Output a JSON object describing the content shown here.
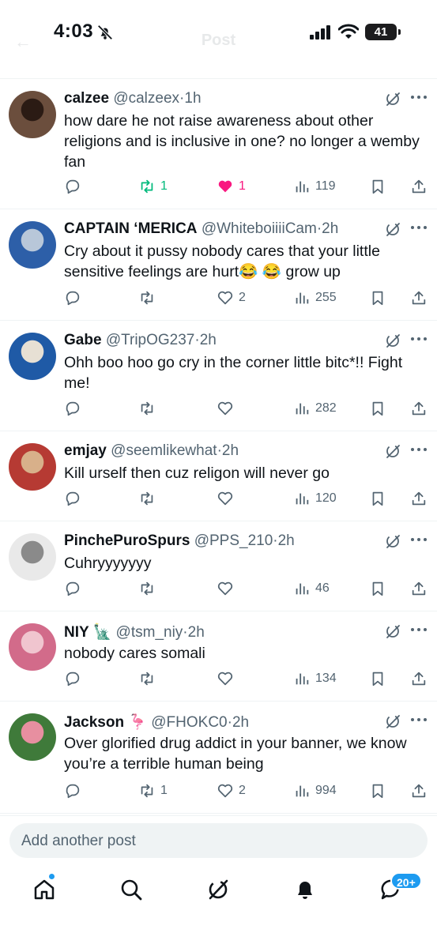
{
  "status_bar": {
    "time": "4:03",
    "battery": "41"
  },
  "header": {
    "title": "Post"
  },
  "replies": [
    {
      "name": "calzee",
      "handle": "@calzeex",
      "age": "1h",
      "text": "how dare he not raise awareness about other religions and is inclusive in one? no longer a wemby fan",
      "reposts": "1",
      "likes": "1",
      "views": "119",
      "reposted": true,
      "liked": true
    },
    {
      "name": "CAPTAIN ‘MERICA",
      "handle": "@WhiteboiiiiCam",
      "age": "2h",
      "text": "Cry about it pussy nobody cares that your little sensitive feelings are hurt😂 😂 grow up",
      "reposts": "",
      "likes": "2",
      "views": "255",
      "reposted": false,
      "liked": false
    },
    {
      "name": "Gabe",
      "handle": "@TripOG237",
      "age": "2h",
      "text": "Ohh boo hoo go cry in the corner little bitc*!! Fight me!",
      "reposts": "",
      "likes": "",
      "views": "282",
      "reposted": false,
      "liked": false
    },
    {
      "name": "emjay",
      "handle": "@seemlikewhat",
      "age": "2h",
      "text": "Kill urself then cuz religon will never go",
      "reposts": "",
      "likes": "",
      "views": "120",
      "reposted": false,
      "liked": false
    },
    {
      "name": "PinchePuroSpurs",
      "handle": "@PPS_210",
      "age": "2h",
      "text": "Cuhryyyyyyy",
      "reposts": "",
      "likes": "",
      "views": "46",
      "reposted": false,
      "liked": false
    },
    {
      "name": "NIY 🗽",
      "handle": "@tsm_niy",
      "age": "2h",
      "text": "nobody cares somali",
      "reposts": "",
      "likes": "",
      "views": "134",
      "reposted": false,
      "liked": false
    },
    {
      "name": "Jackson 🦩",
      "handle": "@FHOKC0",
      "age": "2h",
      "text": "Over glorified drug addict in your banner, we know you’re a terrible human being",
      "reposts": "1",
      "likes": "2",
      "views": "994",
      "reposted": false,
      "liked": false
    }
  ],
  "compose": {
    "placeholder": "Add another post"
  },
  "tabbar": {
    "messages_badge": "20+"
  },
  "colors": {
    "accent": "#1d9bf0",
    "repost": "#00ba7c",
    "like": "#f91880",
    "secondary": "#536471"
  },
  "icons": [
    "bell-off-icon",
    "grok-icon",
    "more-icon",
    "reply-icon",
    "repost-icon",
    "like-icon",
    "views-icon",
    "bookmark-icon",
    "share-icon",
    "home-icon",
    "search-icon",
    "notifications-icon",
    "messages-icon"
  ]
}
